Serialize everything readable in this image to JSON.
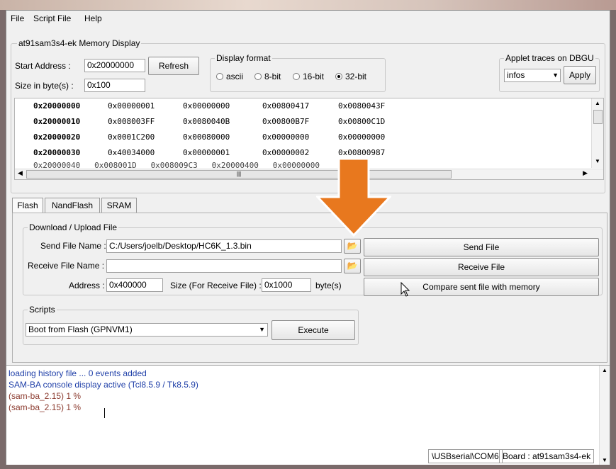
{
  "menu": [
    "File",
    "Script File",
    "Help"
  ],
  "memory": {
    "title": "at91sam3s4-ek Memory Display",
    "start_label": "Start Address :",
    "start_value": "0x20000000",
    "size_label": "Size in byte(s) :",
    "size_value": "0x100",
    "refresh": "Refresh",
    "format_title": "Display format",
    "formats": [
      "ascii",
      "8-bit",
      "16-bit",
      "32-bit"
    ],
    "selected_format": "32-bit",
    "applet_title": "Applet traces on DBGU",
    "applet_value": "infos",
    "apply": "Apply",
    "rows": [
      [
        "0x20000000",
        "0x00000001",
        "0x00000000",
        "0x00800417",
        "0x0080043F"
      ],
      [
        "0x20000010",
        "0x008003FF",
        "0x0080040B",
        "0x00800B7F",
        "0x00800C1D"
      ],
      [
        "0x20000020",
        "0x0001C200",
        "0x00080000",
        "0x00000000",
        "0x00000000"
      ],
      [
        "0x20000030",
        "0x40034000",
        "0x00000001",
        "0x00000002",
        "0x00800987"
      ]
    ],
    "partial_row": "0x20000040   0x008001D   0x008009C3   0x20000400   0x00000000"
  },
  "tabs": [
    "Flash",
    "NandFlash",
    "SRAM"
  ],
  "active_tab": "Flash",
  "download": {
    "title": "Download / Upload File",
    "send_label": "Send File Name :",
    "send_value": "C:/Users/joelb/Desktop/HC6K_1.3.bin",
    "receive_label": "Receive File Name :",
    "receive_value": "",
    "address_label": "Address :",
    "address_value": "0x400000",
    "size_label": "Size (For Receive File) :",
    "size_value": "0x1000",
    "bytes_label": "byte(s)",
    "send_button": "Send File",
    "receive_button": "Receive File",
    "compare_button": "Compare sent file with memory"
  },
  "scripts": {
    "title": "Scripts",
    "selected": "Boot from Flash (GPNVM1)",
    "execute": "Execute"
  },
  "console": [
    {
      "text": "loading history file ... 0 events added",
      "color": "#1f3fa8"
    },
    {
      "text": "SAM-BA console display active (Tcl8.5.9 / Tk8.5.9)",
      "color": "#1f3fa8"
    },
    {
      "text": "(sam-ba_2.15) 1 %",
      "color": "#8b3a2e"
    },
    {
      "text": "(sam-ba_2.15) 1 %",
      "color": "#8b3a2e"
    }
  ],
  "status": {
    "port": "\\USBserial\\COM6",
    "board": "Board : at91sam3s4-ek"
  },
  "colors": {
    "accent_arrow": "#e8781e",
    "console_info": "#1f3fa8",
    "console_prompt": "#8b3a2e"
  }
}
